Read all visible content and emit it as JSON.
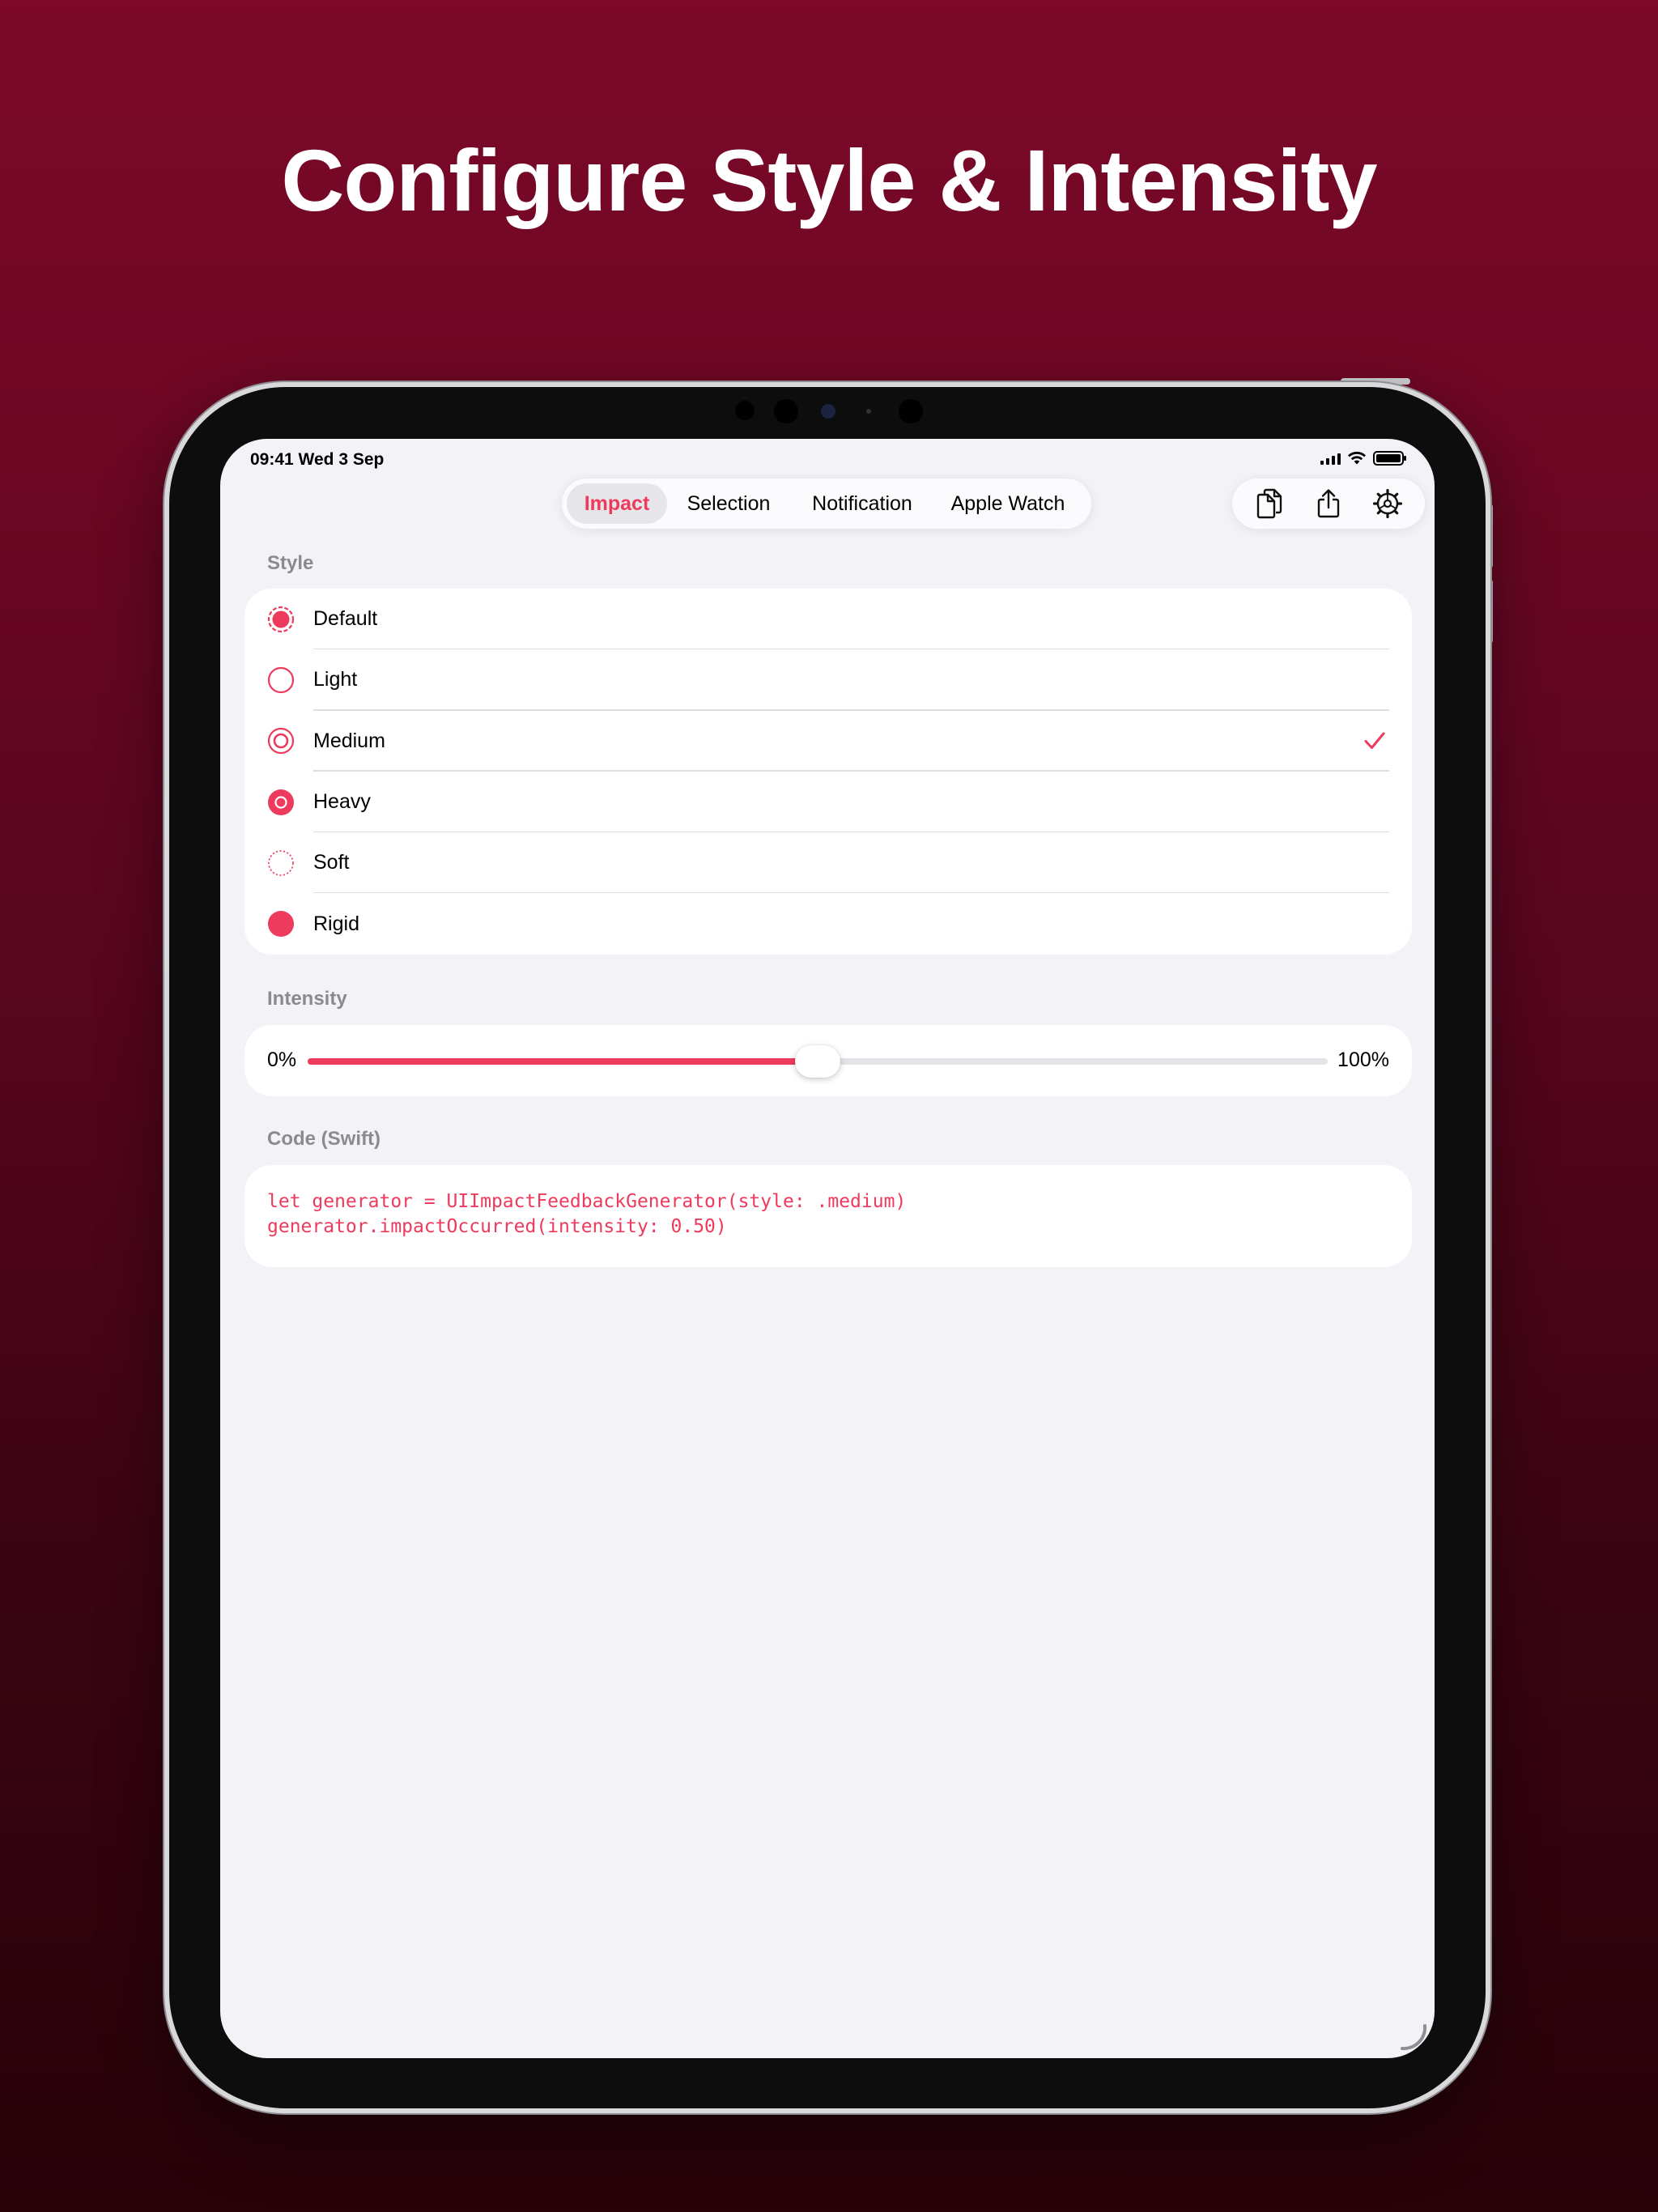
{
  "headline": "Configure Style & Intensity",
  "status_bar": {
    "time": "09:41  Wed 3 Sep"
  },
  "tabs": [
    {
      "label": "Impact",
      "active": true
    },
    {
      "label": "Selection",
      "active": false
    },
    {
      "label": "Notification",
      "active": false
    },
    {
      "label": "Apple Watch",
      "active": false
    }
  ],
  "toolbar": {
    "icons": [
      "copy-icon",
      "share-icon",
      "settings-gear-icon"
    ]
  },
  "style_section": {
    "label": "Style",
    "options": [
      {
        "label": "Default",
        "icon": "radio-default-icon",
        "selected": false
      },
      {
        "label": "Light",
        "icon": "radio-light-icon",
        "selected": false
      },
      {
        "label": "Medium",
        "icon": "radio-medium-icon",
        "selected": true
      },
      {
        "label": "Heavy",
        "icon": "radio-heavy-icon",
        "selected": false
      },
      {
        "label": "Soft",
        "icon": "radio-soft-icon",
        "selected": false
      },
      {
        "label": "Rigid",
        "icon": "radio-rigid-icon",
        "selected": false
      }
    ]
  },
  "intensity_section": {
    "label": "Intensity",
    "min_label": "0%",
    "max_label": "100%",
    "value": 0.5
  },
  "code_section": {
    "label": "Code (Swift)",
    "lines": [
      "let generator = UIImpactFeedbackGenerator(style: .medium)",
      "generator.impactOccurred(intensity: 0.50)"
    ]
  },
  "colors": {
    "accent": "#ee3a5c",
    "background_top": "#7d0829",
    "background_bottom": "#270209",
    "screen_background": "#f2f2f7"
  }
}
